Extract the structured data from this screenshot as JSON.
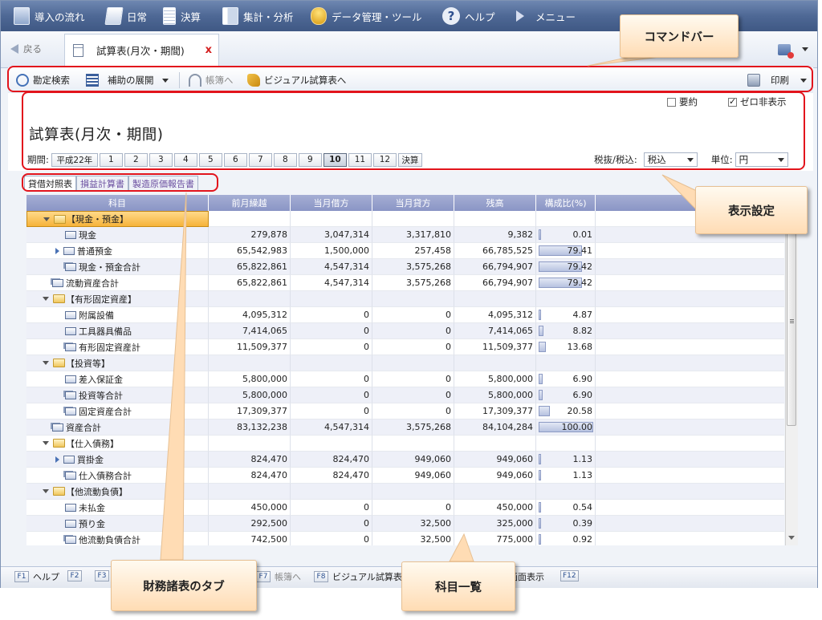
{
  "menu": {
    "items": [
      {
        "label": "導入の流れ",
        "icon": "flow-icon"
      },
      {
        "label": "日常",
        "icon": "daily-icon"
      },
      {
        "label": "決算",
        "icon": "closing-icon"
      },
      {
        "label": "集計・分析",
        "icon": "report-icon"
      },
      {
        "label": "データ管理・ツール",
        "icon": "data-icon"
      },
      {
        "label": "ヘルプ",
        "icon": "help-icon",
        "glyph": "?"
      },
      {
        "label": "メニュー",
        "icon": "menu-icon"
      }
    ]
  },
  "tabstrip": {
    "back_label": "戻る",
    "doc_tab_title": "試算表(月次・期間)",
    "close_glyph": "x"
  },
  "commandbar": {
    "account_search": "勘定検索",
    "expand_sub": "補助の展開",
    "ledger": "帳簿へ",
    "visual": "ビジュアル試算表へ",
    "print": "印刷"
  },
  "settings": {
    "summary_label": "要約",
    "summary_checked": false,
    "zero_hide_label": "ゼロ非表示",
    "zero_hide_checked": true,
    "title": "試算表(月次・期間)",
    "period_label": "期間:",
    "year_button": "平成22年",
    "months": [
      "1",
      "2",
      "3",
      "4",
      "5",
      "6",
      "7",
      "8",
      "9",
      "10",
      "11",
      "12"
    ],
    "selected_month": "10",
    "closing_button": "決算",
    "tax_label": "税抜/税込:",
    "tax_value": "税込",
    "unit_label": "単位:",
    "unit_value": "円"
  },
  "fs_tabs": [
    {
      "label": "貸借対照表",
      "active": true
    },
    {
      "label": "損益計算書",
      "active": false
    },
    {
      "label": "製造原価報告書",
      "active": false
    }
  ],
  "grid": {
    "columns": [
      "科目",
      "前月繰越",
      "当月借方",
      "当月貸方",
      "残高",
      "構成比(%)"
    ],
    "rows": [
      {
        "name": "【現金・預金】",
        "type": "group",
        "level": 1,
        "selected": true
      },
      {
        "name": "現金",
        "type": "account",
        "level": 2,
        "values": [
          "279,878",
          "3,047,314",
          "3,317,810",
          "9,382"
        ],
        "ratio": "0.01",
        "ratio_value": 0.01
      },
      {
        "name": "普通預金",
        "type": "account",
        "level": 2,
        "expandable": true,
        "values": [
          "65,542,983",
          "1,500,000",
          "257,458",
          "66,785,525"
        ],
        "ratio": "79.41",
        "ratio_value": 79.41
      },
      {
        "name": "現金・預金合計",
        "type": "sum",
        "level": 2,
        "values": [
          "65,822,861",
          "4,547,314",
          "3,575,268",
          "66,794,907"
        ],
        "ratio": "79.42",
        "ratio_value": 79.42
      },
      {
        "name": "流動資産合計",
        "type": "sum",
        "level": 1,
        "values": [
          "65,822,861",
          "4,547,314",
          "3,575,268",
          "66,794,907"
        ],
        "ratio": "79.42",
        "ratio_value": 79.42
      },
      {
        "name": "【有形固定資産】",
        "type": "group",
        "level": 1
      },
      {
        "name": "附属設備",
        "type": "account",
        "level": 2,
        "values": [
          "4,095,312",
          "0",
          "0",
          "4,095,312"
        ],
        "ratio": "4.87",
        "ratio_value": 4.87
      },
      {
        "name": "工具器具備品",
        "type": "account",
        "level": 2,
        "values": [
          "7,414,065",
          "0",
          "0",
          "7,414,065"
        ],
        "ratio": "8.82",
        "ratio_value": 8.82
      },
      {
        "name": "有形固定資産計",
        "type": "sum",
        "level": 2,
        "values": [
          "11,509,377",
          "0",
          "0",
          "11,509,377"
        ],
        "ratio": "13.68",
        "ratio_value": 13.68
      },
      {
        "name": "【投資等】",
        "type": "group",
        "level": 1
      },
      {
        "name": "差入保証金",
        "type": "account",
        "level": 2,
        "values": [
          "5,800,000",
          "0",
          "0",
          "5,800,000"
        ],
        "ratio": "6.90",
        "ratio_value": 6.9
      },
      {
        "name": "投資等合計",
        "type": "sum",
        "level": 2,
        "values": [
          "5,800,000",
          "0",
          "0",
          "5,800,000"
        ],
        "ratio": "6.90",
        "ratio_value": 6.9
      },
      {
        "name": "固定資産合計",
        "type": "sum",
        "level": 2,
        "values": [
          "17,309,377",
          "0",
          "0",
          "17,309,377"
        ],
        "ratio": "20.58",
        "ratio_value": 20.58
      },
      {
        "name": "資産合計",
        "type": "sum",
        "level": 1,
        "values": [
          "83,132,238",
          "4,547,314",
          "3,575,268",
          "84,104,284"
        ],
        "ratio": "100.00",
        "ratio_value": 100.0
      },
      {
        "name": "【仕入債務】",
        "type": "group",
        "level": 1
      },
      {
        "name": "買掛金",
        "type": "account",
        "level": 2,
        "expandable": true,
        "values": [
          "824,470",
          "824,470",
          "949,060",
          "949,060"
        ],
        "ratio": "1.13",
        "ratio_value": 1.13
      },
      {
        "name": "仕入債務合計",
        "type": "sum",
        "level": 2,
        "values": [
          "824,470",
          "824,470",
          "949,060",
          "949,060"
        ],
        "ratio": "1.13",
        "ratio_value": 1.13
      },
      {
        "name": "【他流動負債】",
        "type": "group",
        "level": 1
      },
      {
        "name": "未払金",
        "type": "account",
        "level": 2,
        "values": [
          "450,000",
          "0",
          "0",
          "450,000"
        ],
        "ratio": "0.54",
        "ratio_value": 0.54
      },
      {
        "name": "預り金",
        "type": "account",
        "level": 2,
        "values": [
          "292,500",
          "0",
          "32,500",
          "325,000"
        ],
        "ratio": "0.39",
        "ratio_value": 0.39
      },
      {
        "name": "他流動負債合計",
        "type": "sum",
        "level": 2,
        "values": [
          "742,500",
          "0",
          "32,500",
          "775,000"
        ],
        "ratio": "0.92",
        "ratio_value": 0.92
      }
    ]
  },
  "fkeys": [
    {
      "key": "F1",
      "label": "ヘルプ"
    },
    {
      "key": "F2",
      "label": ""
    },
    {
      "key": "F3",
      "label": ""
    },
    {
      "key": "F7",
      "label": "帳簿へ",
      "muted": true
    },
    {
      "key": "F8",
      "label": "ビジュアル試算表へ"
    },
    {
      "key": "",
      "label": "画面表示"
    },
    {
      "key": "F12",
      "label": ""
    }
  ],
  "callouts": {
    "command_bar": "コマンドバー",
    "display_settings": "表示設定",
    "fs_tabs": "財務諸表のタブ",
    "account_list": "科目一覧"
  },
  "colors": {
    "highlight": "#e2141c",
    "menubar": "#4e6895",
    "grid_header": "#8a95c5",
    "selected_row": "#f6b33a",
    "callout": "#ffdcb4"
  }
}
